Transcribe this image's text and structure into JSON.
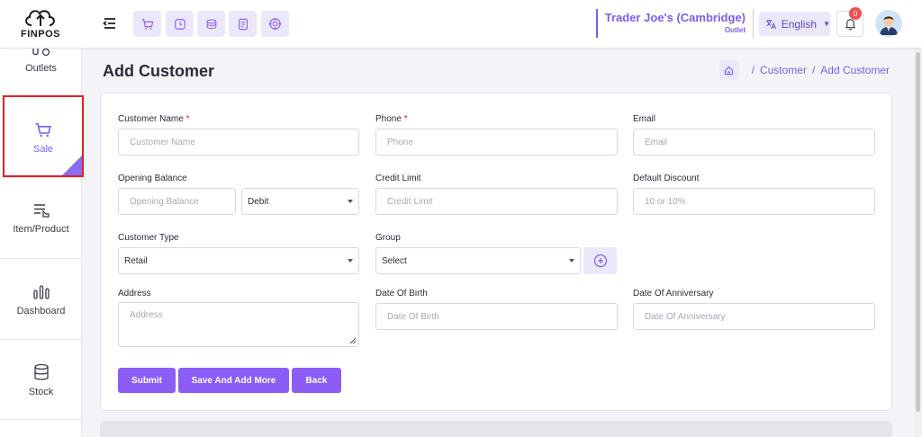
{
  "logo": {
    "text": "FINPOS"
  },
  "header": {
    "outlet_name": "Trader Joe's (Cambridge)",
    "outlet_label": "Outlet",
    "language": "English",
    "notification_count": "0"
  },
  "sidebar": {
    "items": [
      {
        "label": "Outlets",
        "icon": "outlets-icon"
      },
      {
        "label": "Sale",
        "icon": "cart-icon"
      },
      {
        "label": "Item/Product",
        "icon": "item-list-icon"
      },
      {
        "label": "Dashboard",
        "icon": "bar-chart-icon"
      },
      {
        "label": "Stock",
        "icon": "database-icon"
      }
    ]
  },
  "page": {
    "title": "Add Customer",
    "breadcrumb": [
      "Customer",
      "Add Customer"
    ]
  },
  "form": {
    "customer_name": {
      "label": "Customer Name",
      "placeholder": "Customer Name",
      "required": "*"
    },
    "phone": {
      "label": "Phone",
      "placeholder": "Phone",
      "required": "*"
    },
    "email": {
      "label": "Email",
      "placeholder": "Email"
    },
    "opening_balance": {
      "label": "Opening Balance",
      "placeholder": "Opening Balance",
      "type_value": "Debit"
    },
    "credit_limit": {
      "label": "Credit Limit",
      "placeholder": "Credit Limit"
    },
    "default_discount": {
      "label": "Default Discount",
      "placeholder": "10 or 10%"
    },
    "customer_type": {
      "label": "Customer Type",
      "value": "Retail"
    },
    "group": {
      "label": "Group",
      "value": "Select"
    },
    "address": {
      "label": "Address",
      "placeholder": "Address"
    },
    "date_of_birth": {
      "label": "Date Of Birth",
      "placeholder": "Date Of Birth"
    },
    "date_of_anniversary": {
      "label": "Date Of Anniversary",
      "placeholder": "Date Of Anniversary"
    }
  },
  "buttons": {
    "submit": "Submit",
    "save_and_add_more": "Save And Add More",
    "back": "Back"
  },
  "colors": {
    "accent": "#8b5cf6",
    "accent_light": "#ece8fc",
    "required": "#e02020"
  }
}
